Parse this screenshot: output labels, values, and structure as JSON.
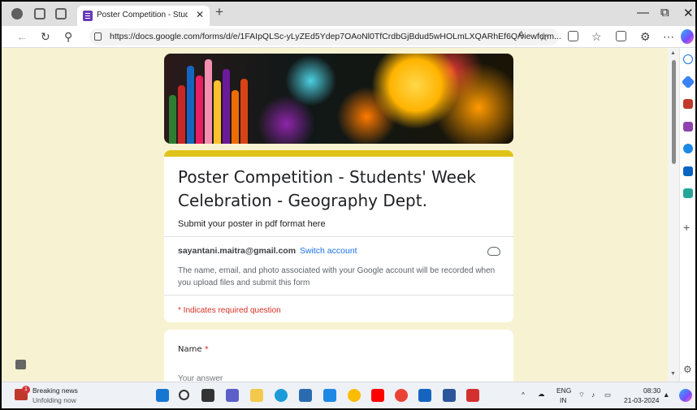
{
  "browser": {
    "tab_title": "Poster Competition - Students' W",
    "url": "https://docs.google.com/forms/d/e/1FAIpQLSc-yLyZEd5Ydep7OAoNl0TfCrdbGjBdud5wHOLmLXQARhEf6Q/viewform..."
  },
  "form": {
    "title": "Poster Competition - Students' Week Celebration - Geography Dept.",
    "description": "Submit your poster in pdf format here",
    "account_email": "sayantani.maitra@gmail.com",
    "switch_account": "Switch account",
    "notice": "The name, email, and photo associated with your Google account will be recorded when you upload files and submit this form",
    "required_note": "* Indicates required question",
    "question_label": "Name",
    "required_star": "*",
    "answer_placeholder": "Your answer"
  },
  "taskbar": {
    "news_title": "Breaking news",
    "news_subtitle": "Unfolding now",
    "news_badge": "1",
    "lang_top": "ENG",
    "lang_bottom": "IN",
    "time": "08:30",
    "date": "21-03-2024"
  }
}
